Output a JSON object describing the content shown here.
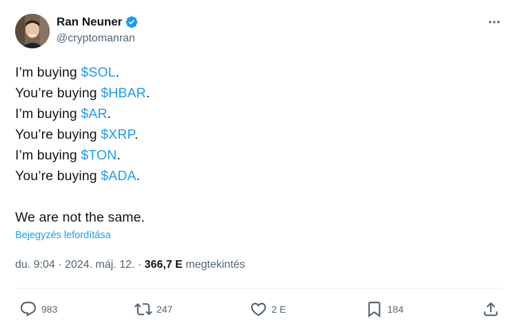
{
  "author": {
    "name": "Ran Neuner",
    "handle": "@cryptomanran",
    "verified_color": "#1d9bf0"
  },
  "tweet": {
    "lines": [
      {
        "prefix": "I’m buying ",
        "tag": "$SOL",
        "suffix": "."
      },
      {
        "prefix": "You’re buying ",
        "tag": "$HBAR",
        "suffix": "."
      },
      {
        "prefix": "I’m buying ",
        "tag": "$AR",
        "suffix": "."
      },
      {
        "prefix": "You’re buying ",
        "tag": "$XRP",
        "suffix": "."
      },
      {
        "prefix": "I’m buying ",
        "tag": "$TON",
        "suffix": "."
      },
      {
        "prefix": "You’re buying ",
        "tag": "$ADA",
        "suffix": "."
      }
    ],
    "closing": "We are not the same."
  },
  "translate_label": "Bejegyzés lefordítása",
  "meta": {
    "time": "du. 9:04",
    "separator": " · ",
    "date": "2024. máj. 12.",
    "views_count": "366,7 E",
    "views_label": " megtekintés"
  },
  "actions": {
    "replies": "983",
    "reposts": "247",
    "likes": "2 E",
    "bookmarks": "184"
  },
  "icons": {
    "more": "more-horizontal-icon",
    "reply": "speech-bubble-icon",
    "repost": "repost-arrows-icon",
    "like": "heart-icon",
    "bookmark": "bookmark-icon",
    "share": "share-upload-icon",
    "verified": "verified-badge-icon"
  },
  "colors": {
    "accent": "#1d9bf0",
    "text": "#0f1419",
    "secondary": "#536471"
  }
}
